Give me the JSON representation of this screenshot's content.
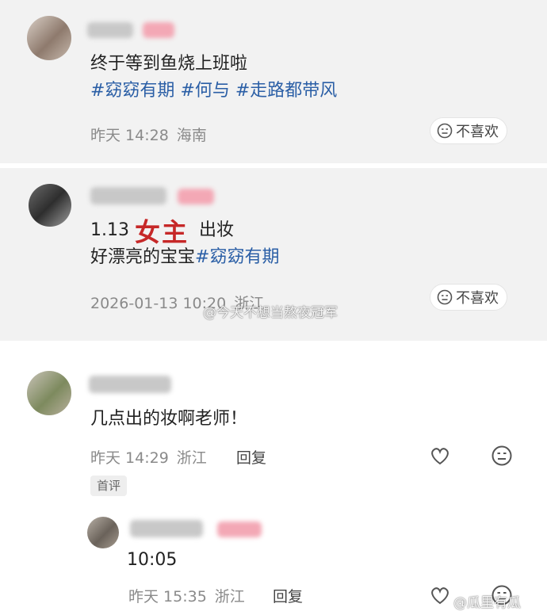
{
  "comments": [
    {
      "text": "终于等到鱼烧上班啦",
      "tags": [
        "#窈窈有期",
        "#何与",
        "#走路都带风"
      ],
      "time": "昨天 14:28",
      "location": "海南",
      "dislike_label": "不喜欢"
    },
    {
      "line1_prefix": "1.13",
      "overlay_text": "女主",
      "line1_suffix": "出妆",
      "line2_text": "好漂亮的宝宝",
      "line2_tag": "#窈窈有期",
      "time": "2026-01-13 10:20",
      "location": "浙江",
      "dislike_label": "不喜欢"
    },
    {
      "text": "几点出的妆啊老师！",
      "time": "昨天 14:29",
      "location": "浙江",
      "reply_label": "回复",
      "badge": "首评"
    },
    {
      "text": "10:05",
      "time": "昨天 15:35",
      "location": "浙江",
      "reply_label": "回复"
    }
  ],
  "watermarks": {
    "middle": "@今天不想当熬夜冠军",
    "bottom": "@瓜里有瓜"
  },
  "colors": {
    "tag": "#2b5fa6",
    "card_bg": "#f2f2f2",
    "overlay_red": "#c62828"
  }
}
